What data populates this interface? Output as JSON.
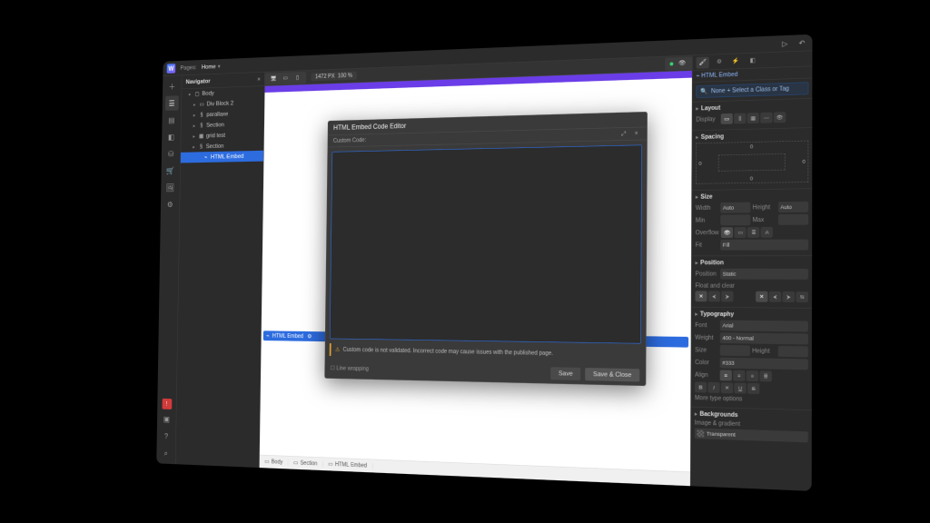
{
  "topbar": {
    "breadcrumb_label": "Pages:",
    "page_name": "Home"
  },
  "canvas_toolbar": {
    "width_px": "1472 PX",
    "zoom": "100 %"
  },
  "navigator": {
    "title": "Navigator",
    "tree": [
      {
        "label": "Body",
        "depth": 0,
        "icon": "▢",
        "selected": false
      },
      {
        "label": "Div Block 2",
        "depth": 1,
        "icon": "▭",
        "selected": false
      },
      {
        "label": "parallaxe",
        "depth": 1,
        "icon": "§",
        "selected": false
      },
      {
        "label": "Section",
        "depth": 1,
        "icon": "§",
        "selected": false
      },
      {
        "label": "grid test",
        "depth": 1,
        "icon": "▦",
        "selected": false
      },
      {
        "label": "Section",
        "depth": 1,
        "icon": "§",
        "selected": false
      },
      {
        "label": "HTML Embed",
        "depth": 2,
        "icon": "⌁",
        "selected": true
      }
    ]
  },
  "canvas": {
    "selection_label": "HTML Embed",
    "breadcrumbs": [
      "Body",
      "Section",
      "HTML Embed"
    ]
  },
  "modal": {
    "title": "HTML Embed Code Editor",
    "subtitle": "Custom Code:",
    "warning": "Custom code is not validated. Incorrect code may cause issues with the published page.",
    "line_wrapping": "Line wrapping",
    "btn_save": "Save",
    "btn_save_close": "Save & Close"
  },
  "style": {
    "element_label": "HTML Embed",
    "class_placeholder": "None + Select a Class or Tag",
    "sections": {
      "layout": "Layout",
      "spacing": "Spacing",
      "size": "Size",
      "position": "Position",
      "typography": "Typography",
      "backgrounds": "Backgrounds"
    },
    "display_label": "Display",
    "spacing_zero": "0",
    "size": {
      "width_lbl": "Width",
      "width": "Auto",
      "height_lbl": "Height",
      "height": "Auto",
      "min_lbl": "Min",
      "max_lbl": "Max",
      "overflow_lbl": "Overflow",
      "fit_lbl": "Fit",
      "fit_val": "Fill"
    },
    "position": {
      "label": "Position",
      "value": "Static",
      "float_label": "Float and clear"
    },
    "typography": {
      "font_lbl": "Font",
      "font_val": "Arial",
      "weight_lbl": "Weight",
      "weight_val": "400 - Normal",
      "size_lbl": "Size",
      "height_lbl": "Height",
      "color_lbl": "Color",
      "color_val": "#333",
      "align_lbl": "Align",
      "more_lbl": "More type options"
    },
    "backgrounds": {
      "imggrad_lbl": "Image & gradient",
      "transparent": "Transparent"
    }
  }
}
